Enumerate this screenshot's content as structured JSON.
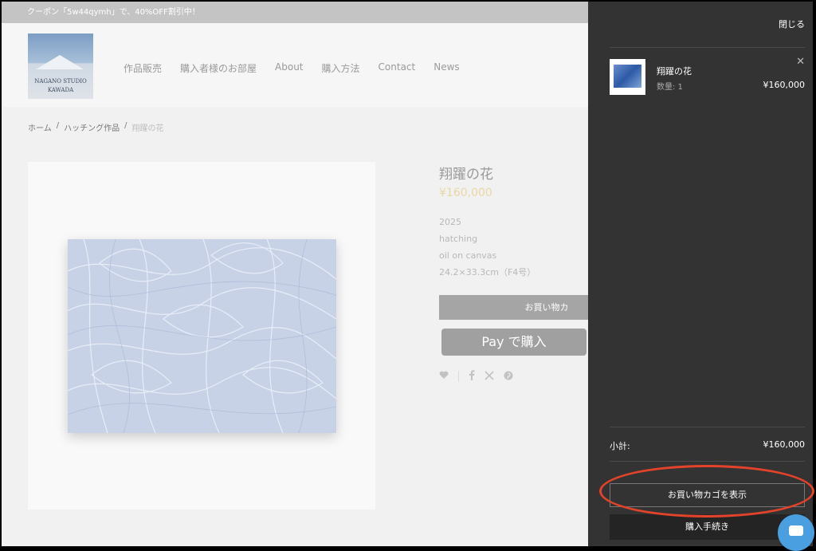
{
  "announcement": "クーポン「5w44qymh」で、40%OFF割引中！",
  "logo": {
    "line1": "NAGANO STUDIO",
    "line2": "KAWADA"
  },
  "nav": [
    "作品販売",
    "購入者様のお部屋",
    "About",
    "購入方法",
    "Contact",
    "News"
  ],
  "breadcrumb": {
    "home": "ホーム",
    "category": "ハッチング作品",
    "current": "翔躍の花",
    "separator": "/"
  },
  "product": {
    "title": "翔躍の花",
    "price": "¥160,000",
    "desc": [
      "2025",
      "hatching",
      "oil on canvas",
      "24.2×33.3cm（F4号）"
    ],
    "add_to_cart": "お買い物カ",
    "apple_pay_label": "Pay で購入"
  },
  "drawer": {
    "close": "閉じる",
    "item": {
      "name": "翔躍の花",
      "qty": "数量: 1",
      "price": "¥160,000"
    },
    "subtotal_label": "小計:",
    "subtotal_value": "¥160,000",
    "view_cart": "お買い物カゴを表示",
    "checkout": "購入手続き"
  },
  "colors": {
    "drawer_bg": "#333333",
    "highlight": "#e2432a",
    "chat": "#4a9fe0"
  },
  "icons": [
    "apple-icon",
    "heart-icon",
    "facebook-icon",
    "x-icon",
    "pinterest-icon",
    "close-icon",
    "chat-icon"
  ]
}
